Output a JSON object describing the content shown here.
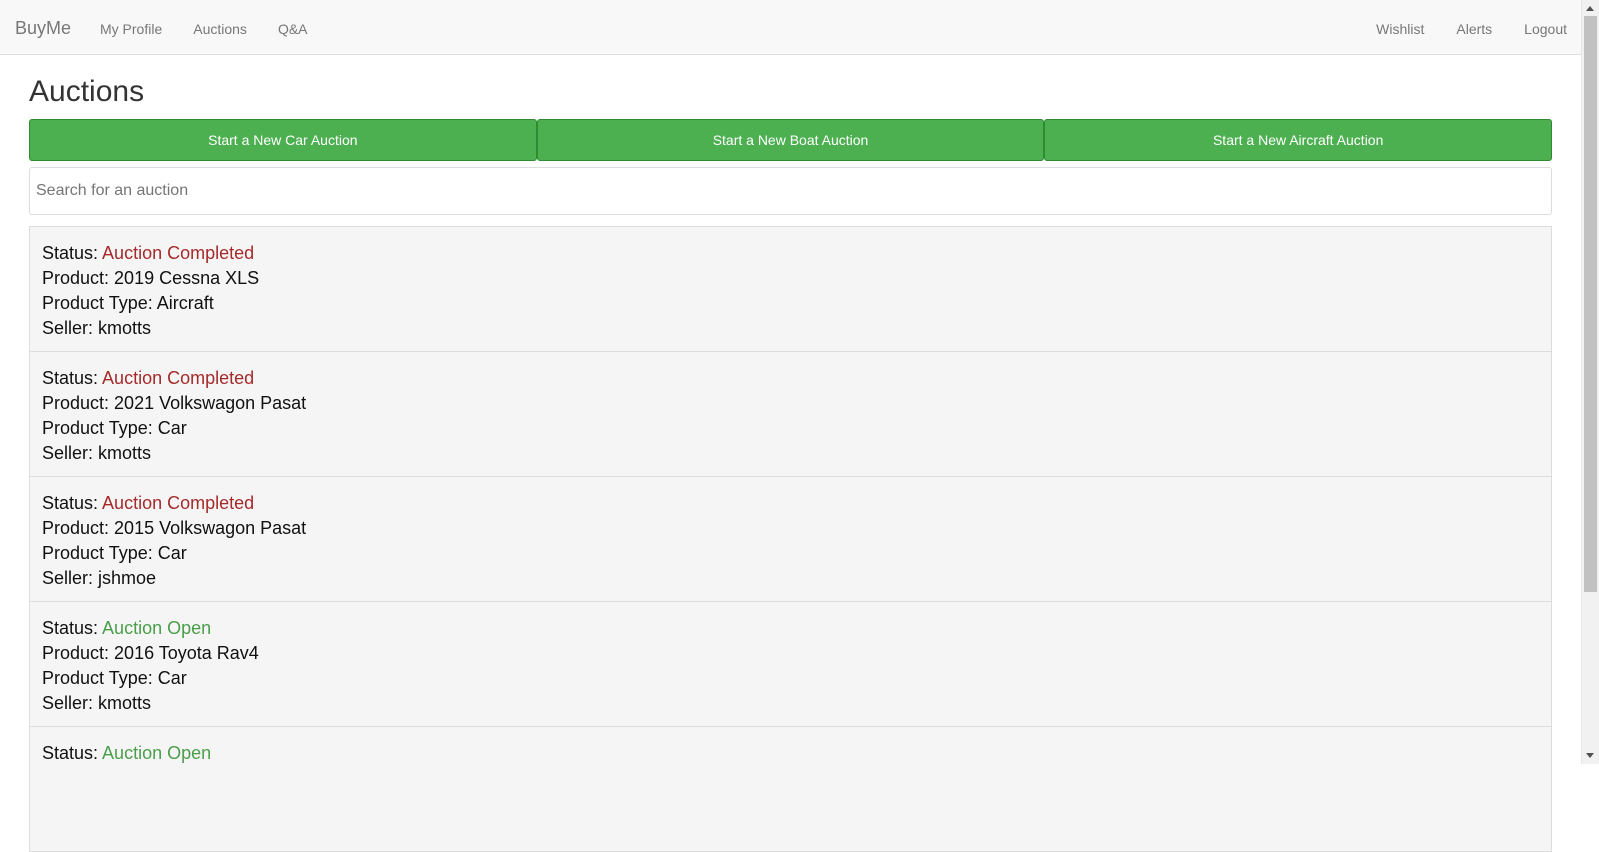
{
  "navbar": {
    "brand": "BuyMe",
    "left_links": [
      "My Profile",
      "Auctions",
      "Q&A"
    ],
    "right_links": [
      "Wishlist",
      "Alerts",
      "Logout"
    ]
  },
  "page": {
    "title": "Auctions",
    "buttons": [
      "Start a New Car Auction",
      "Start a New Boat Auction",
      "Start a New Aircraft Auction"
    ],
    "search_placeholder": "Search for an auction"
  },
  "labels": {
    "status": "Status: ",
    "product": "Product: ",
    "product_type": "Product Type: ",
    "seller": "Seller: "
  },
  "auctions": [
    {
      "status": "Auction Completed",
      "product": "2019 Cessna XLS",
      "type": "Aircraft",
      "seller": "kmotts"
    },
    {
      "status": "Auction Completed",
      "product": "2021 Volkswagon Pasat",
      "type": "Car",
      "seller": "kmotts"
    },
    {
      "status": "Auction Completed",
      "product": "2015 Volkswagon Pasat",
      "type": "Car",
      "seller": "jshmoe"
    },
    {
      "status": "Auction Open",
      "product": "2016 Toyota Rav4",
      "type": "Car",
      "seller": "kmotts"
    },
    {
      "status": "Auction Open",
      "product": "",
      "type": "",
      "seller": ""
    }
  ],
  "colors": {
    "completed": "#a52a2a",
    "open": "#4a9e4a",
    "button": "#4caf50"
  }
}
